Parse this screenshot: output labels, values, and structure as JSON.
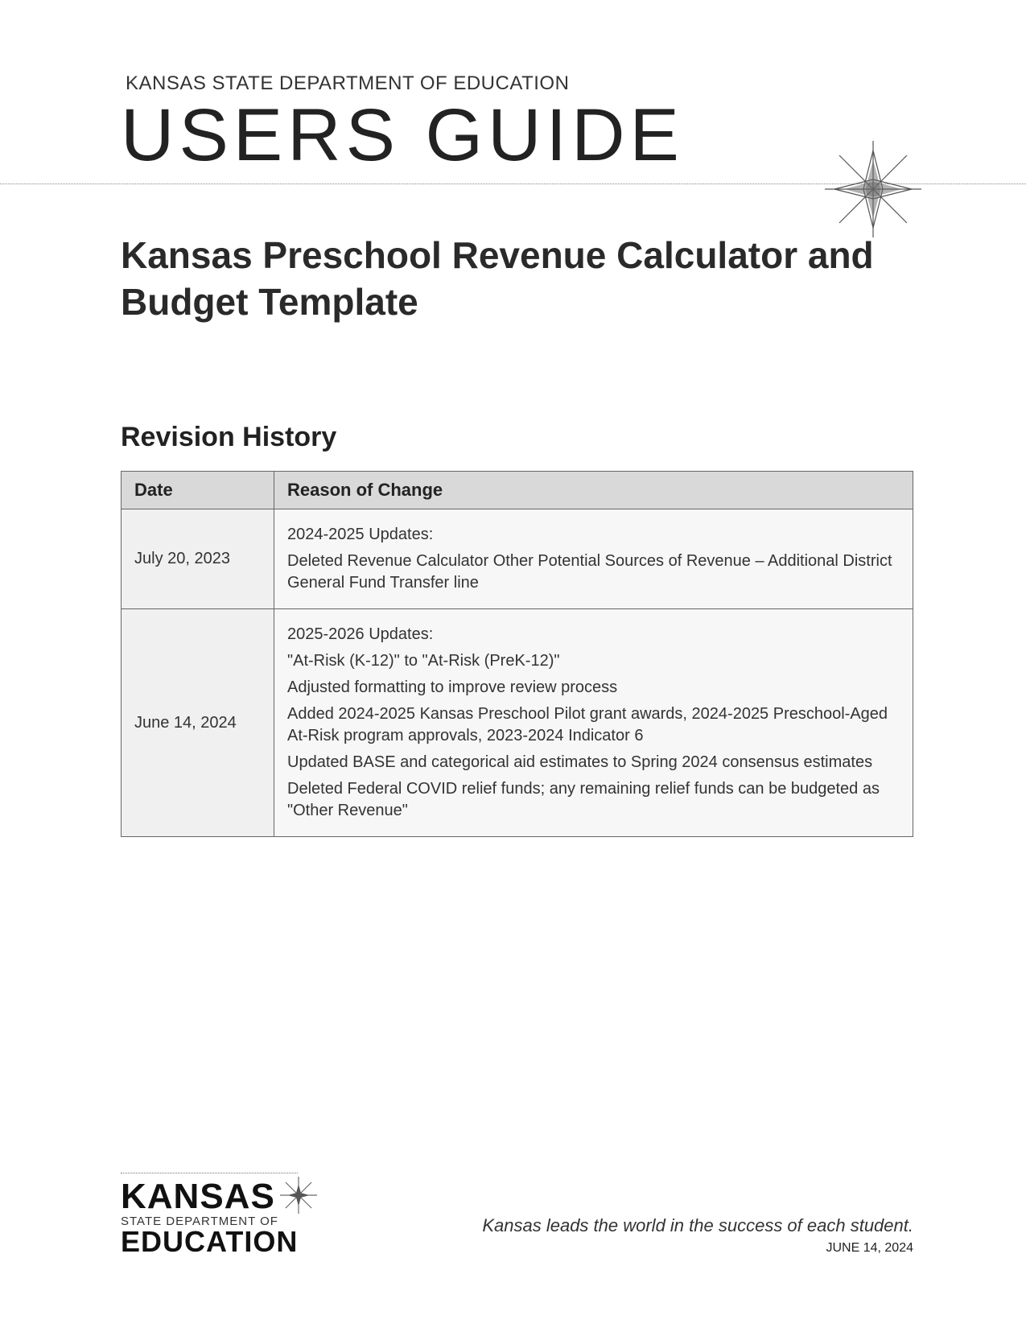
{
  "header": {
    "department": "KANSAS STATE DEPARTMENT OF EDUCATION",
    "title": "USERS GUIDE",
    "subtitle": "Kansas Preschool Revenue Calculator and Budget Template"
  },
  "section": {
    "revision_history_title": "Revision History"
  },
  "table": {
    "headers": {
      "date": "Date",
      "reason": "Reason of Change"
    },
    "rows": [
      {
        "date": "July 20, 2023",
        "reasons": [
          "2024-2025 Updates:",
          "Deleted Revenue Calculator Other Potential Sources of Revenue – Additional District General Fund Transfer line"
        ]
      },
      {
        "date": "June 14, 2024",
        "reasons": [
          "2025-2026 Updates:",
          "\"At-Risk (K-12)\" to \"At-Risk (PreK-12)\"",
          "Adjusted formatting to improve review process",
          "Added 2024-2025 Kansas Preschool Pilot grant awards, 2024-2025 Preschool-Aged At-Risk program approvals, 2023-2024 Indicator 6",
          "Updated BASE and categorical aid estimates to Spring 2024 consensus estimates",
          "Deleted Federal COVID relief funds; any remaining relief funds can be budgeted as \"Other Revenue\""
        ]
      }
    ]
  },
  "footer": {
    "logo": {
      "line1": "KANSAS",
      "line2": "STATE DEPARTMENT OF",
      "line3": "EDUCATION"
    },
    "tagline": "Kansas leads the world in the success of each student.",
    "date": "JUNE 14, 2024"
  }
}
